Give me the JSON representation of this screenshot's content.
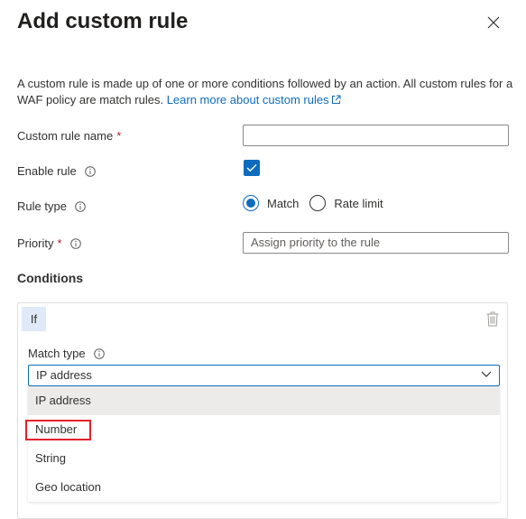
{
  "panel": {
    "title": "Add custom rule",
    "description": "A custom rule is made up of one or more conditions followed by an action. All custom rules for a WAF policy are match rules.",
    "learn_more": "Learn more about custom rules"
  },
  "form": {
    "rule_name_label": "Custom rule name",
    "rule_name_value": "",
    "required_marker": "*",
    "enable_rule_label": "Enable rule",
    "enable_rule_checked": true,
    "rule_type_label": "Rule type",
    "rule_type_options": [
      "Match",
      "Rate limit"
    ],
    "rule_type_selected": "Match",
    "priority_label": "Priority",
    "priority_placeholder": "Assign priority to the rule"
  },
  "conditions": {
    "heading": "Conditions",
    "if_badge": "If",
    "match_type_label": "Match type",
    "match_type_value": "IP address",
    "options": [
      "IP address",
      "Number",
      "String",
      "Geo location"
    ],
    "highlighted_option": "Number"
  },
  "colors": {
    "accent": "#0f6cbd",
    "required": "#a4262c",
    "highlight": "#e3202d",
    "if_badge_bg": "#dfe9f8"
  },
  "icons": {
    "close": "close-icon",
    "info": "info-icon",
    "external_link": "external-link-icon",
    "trash": "trash-icon",
    "chevron": "chevron-down-icon",
    "check": "checkmark-icon"
  }
}
